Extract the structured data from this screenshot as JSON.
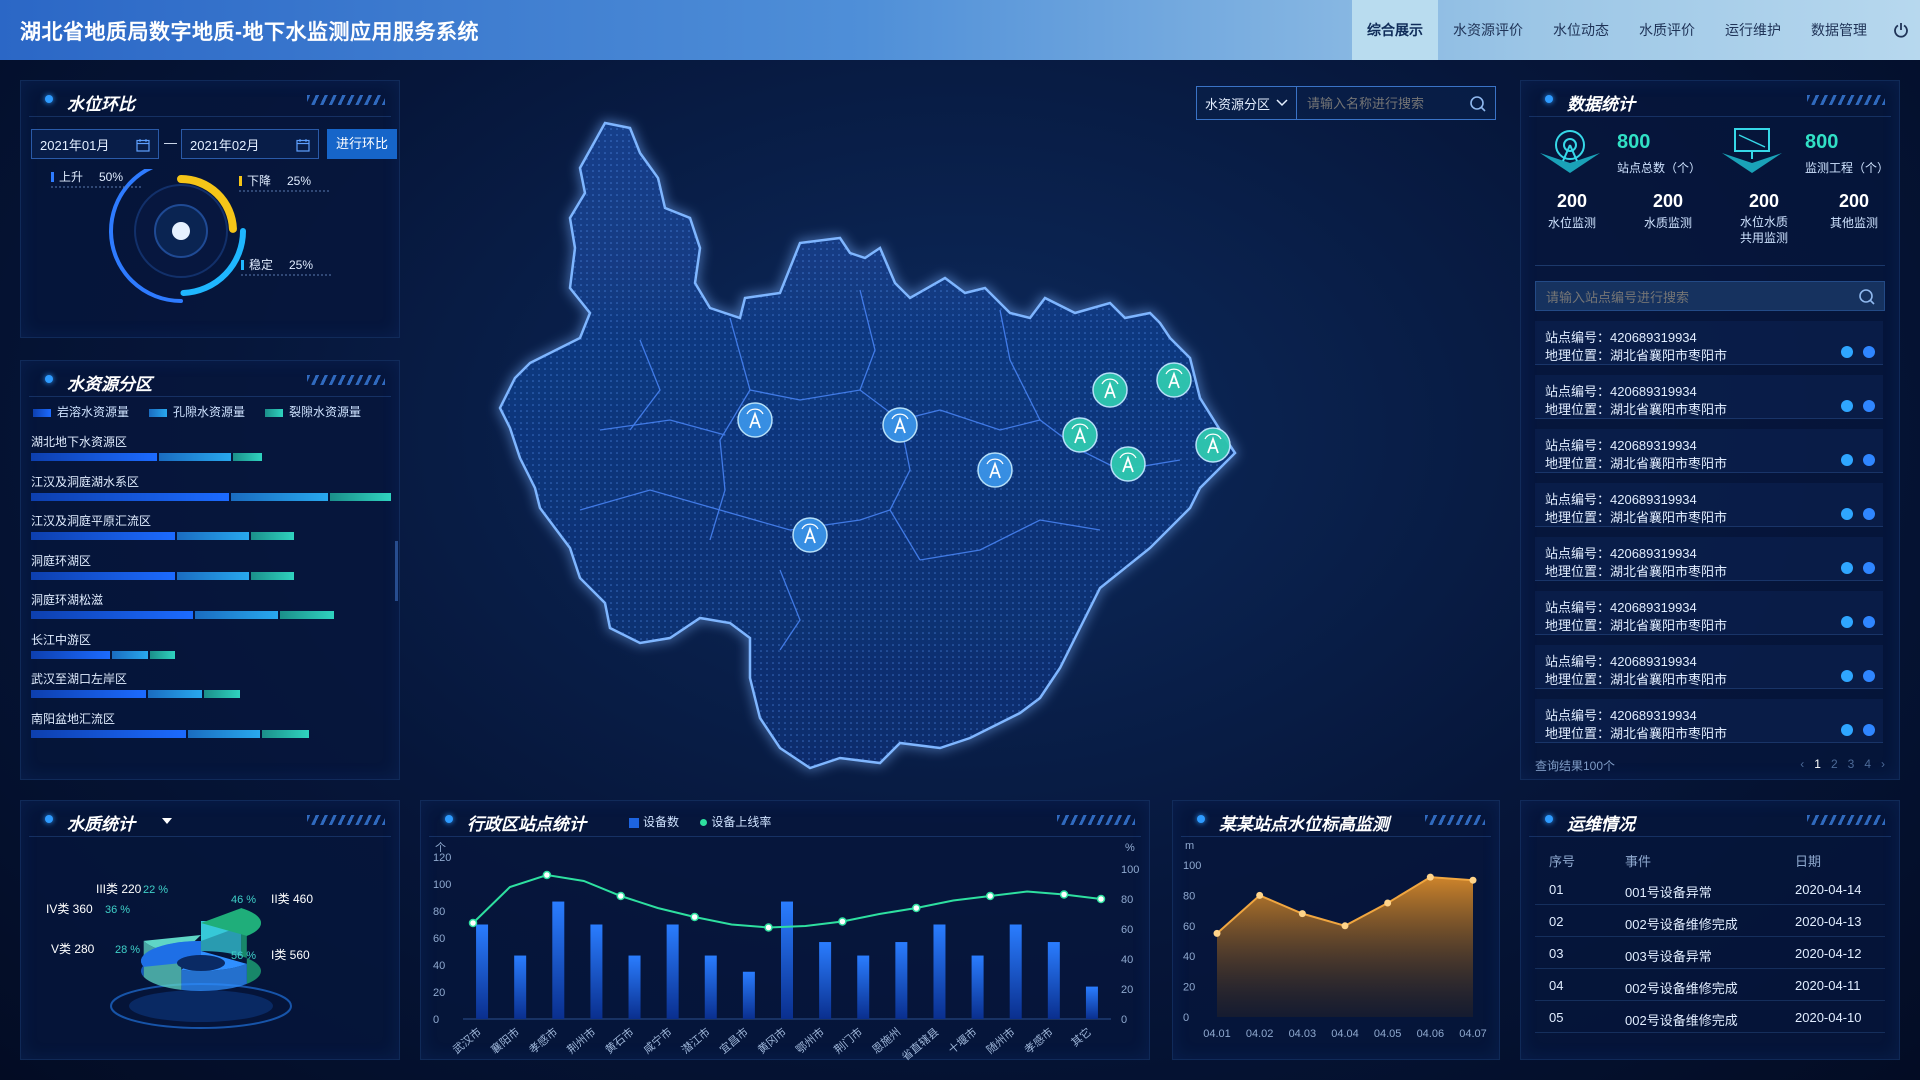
{
  "header": {
    "title": "湖北省地质局数字地质-地下水监测应用服务系统",
    "nav": [
      "综合展示",
      "水资源评价",
      "水位动态",
      "水质评价",
      "运行维护",
      "数据管理"
    ],
    "active_nav": "综合展示"
  },
  "water_level_compare": {
    "title": "水位环比",
    "start_date": "2021年01月",
    "separator": "—",
    "end_date": "2021年02月",
    "button": "进行环比",
    "chart_data": {
      "type": "pie",
      "categories": [
        "上升",
        "下降",
        "稳定"
      ],
      "values": [
        50,
        25,
        25
      ],
      "labels": [
        "50%",
        "25%",
        "25%"
      ],
      "colors": [
        "#2e7bff",
        "#f5c518",
        "#1fb7ff"
      ]
    }
  },
  "water_zones": {
    "title": "水资源分区",
    "legend": [
      "岩溶水资源量",
      "孔隙水资源量",
      "裂隙水资源量"
    ],
    "colors": [
      "#1c6bff",
      "#28a8ee",
      "#2fd3bf"
    ],
    "chart_data": {
      "type": "bar",
      "orientation": "horizontal-stacked",
      "categories": [
        "湖北地下水资源区",
        "江汉及洞庭湖水系区",
        "江汉及洞庭平原汇流区",
        "洞庭环湖区",
        "洞庭环湖松滋",
        "长江中游区",
        "武汉至湖口左岸区",
        "南阳盆地汇流区"
      ],
      "series": [
        {
          "name": "岩溶水资源量",
          "values": [
            35,
            55,
            40,
            40,
            45,
            22,
            32,
            43
          ]
        },
        {
          "name": "孔隙水资源量",
          "values": [
            20,
            27,
            20,
            20,
            23,
            10,
            15,
            20
          ]
        },
        {
          "name": "裂隙水资源量",
          "values": [
            8,
            17,
            12,
            12,
            15,
            7,
            10,
            13
          ]
        }
      ]
    }
  },
  "water_quality": {
    "title": "水质统计",
    "chart_data": {
      "type": "pie",
      "categories": [
        "III类",
        "II类",
        "IV类",
        "V类",
        "I类"
      ],
      "values": [
        220,
        460,
        360,
        280,
        560
      ],
      "percent_labels": [
        "22 %",
        "46 %",
        "36 %",
        "28 %",
        "56 %"
      ],
      "colors": [
        "#36c8d8",
        "#1fae7a",
        "#2f8fff",
        "#5fd6c6",
        "#1e6fe6"
      ]
    }
  },
  "district_stats": {
    "title": "行政区站点统计",
    "legend": [
      "设备数",
      "设备上线率"
    ],
    "left_unit": "个",
    "right_unit": "%",
    "chart_data": {
      "type": "bar",
      "categories": [
        "武汉市",
        "襄阳市",
        "孝感市",
        "荆州市",
        "黄石市",
        "咸宁市",
        "潜江市",
        "宜昌市",
        "黄冈市",
        "鄂州市",
        "荆门市",
        "恩施州",
        "省直辖县",
        "十堰市",
        "随州市",
        "孝感市",
        "其它"
      ],
      "series": [
        {
          "name": "设备数",
          "values": [
            70,
            47,
            87,
            70,
            47,
            70,
            47,
            35,
            87,
            57,
            47,
            57,
            70,
            47,
            70,
            57,
            24
          ]
        },
        {
          "name": "设备上线率",
          "values": [
            64,
            88,
            96,
            92,
            82,
            74,
            68,
            63,
            61,
            62,
            65,
            70,
            74,
            79,
            82,
            85,
            83,
            80
          ]
        }
      ],
      "ylim_left": [
        0,
        120
      ],
      "ylim_right": [
        0,
        100
      ],
      "yticks_left": [
        "120",
        "100",
        "80",
        "60",
        "40",
        "20",
        "0"
      ],
      "yticks_right": [
        "100",
        "80",
        "60",
        "40",
        "20",
        "0"
      ]
    }
  },
  "water_elevation": {
    "title": "某某站点水位标高监测",
    "unit": "m",
    "chart_data": {
      "type": "area",
      "categories": [
        "04.01",
        "04.02",
        "04.03",
        "04.04",
        "04.05",
        "04.06",
        "04.07"
      ],
      "values": [
        55,
        80,
        68,
        60,
        75,
        92,
        90
      ],
      "ylim": [
        0,
        100
      ],
      "yticks": [
        "100",
        "80",
        "60",
        "40",
        "20",
        "0"
      ]
    }
  },
  "data_stats": {
    "title": "数据统计",
    "total_stations": {
      "value": "800",
      "label": "站点总数（个）"
    },
    "monitor_projects": {
      "value": "800",
      "label": "监测工程（个）"
    },
    "sub": [
      {
        "value": "200",
        "label": "水位监测"
      },
      {
        "value": "200",
        "label": "水质监测"
      },
      {
        "value": "200",
        "label": "水位水质共用监测"
      },
      {
        "value": "200",
        "label": "其他监测"
      }
    ],
    "search_placeholder": "请输入站点编号进行搜索",
    "stations": [
      {
        "code_label": "站点编号：420689319934",
        "location_label": "地理位置：湖北省襄阳市枣阳市"
      },
      {
        "code_label": "站点编号：420689319934",
        "location_label": "地理位置：湖北省襄阳市枣阳市"
      },
      {
        "code_label": "站点编号：420689319934",
        "location_label": "地理位置：湖北省襄阳市枣阳市"
      },
      {
        "code_label": "站点编号：420689319934",
        "location_label": "地理位置：湖北省襄阳市枣阳市"
      },
      {
        "code_label": "站点编号：420689319934",
        "location_label": "地理位置：湖北省襄阳市枣阳市"
      },
      {
        "code_label": "站点编号：420689319934",
        "location_label": "地理位置：湖北省襄阳市枣阳市"
      },
      {
        "code_label": "站点编号：420689319934",
        "location_label": "地理位置：湖北省襄阳市枣阳市"
      },
      {
        "code_label": "站点编号：420689319934",
        "location_label": "地理位置：湖北省襄阳市枣阳市"
      }
    ],
    "result_text": "查询结果100个",
    "pages": [
      "1",
      "2",
      "3",
      "4"
    ],
    "current_page": "1"
  },
  "ops": {
    "title": "运维情况",
    "headers": [
      "序号",
      "事件",
      "日期"
    ],
    "rows": [
      [
        "01",
        "001号设备异常",
        "2020-04-14"
      ],
      [
        "02",
        "002号设备维修完成",
        "2020-04-13"
      ],
      [
        "03",
        "003号设备异常",
        "2020-04-12"
      ],
      [
        "04",
        "002号设备维修完成",
        "2020-04-11"
      ],
      [
        "05",
        "002号设备维修完成",
        "2020-04-10"
      ]
    ]
  },
  "map": {
    "zone_select": "水资源分区",
    "search_placeholder": "请输入名称进行搜索",
    "station_marker_count": 9
  }
}
